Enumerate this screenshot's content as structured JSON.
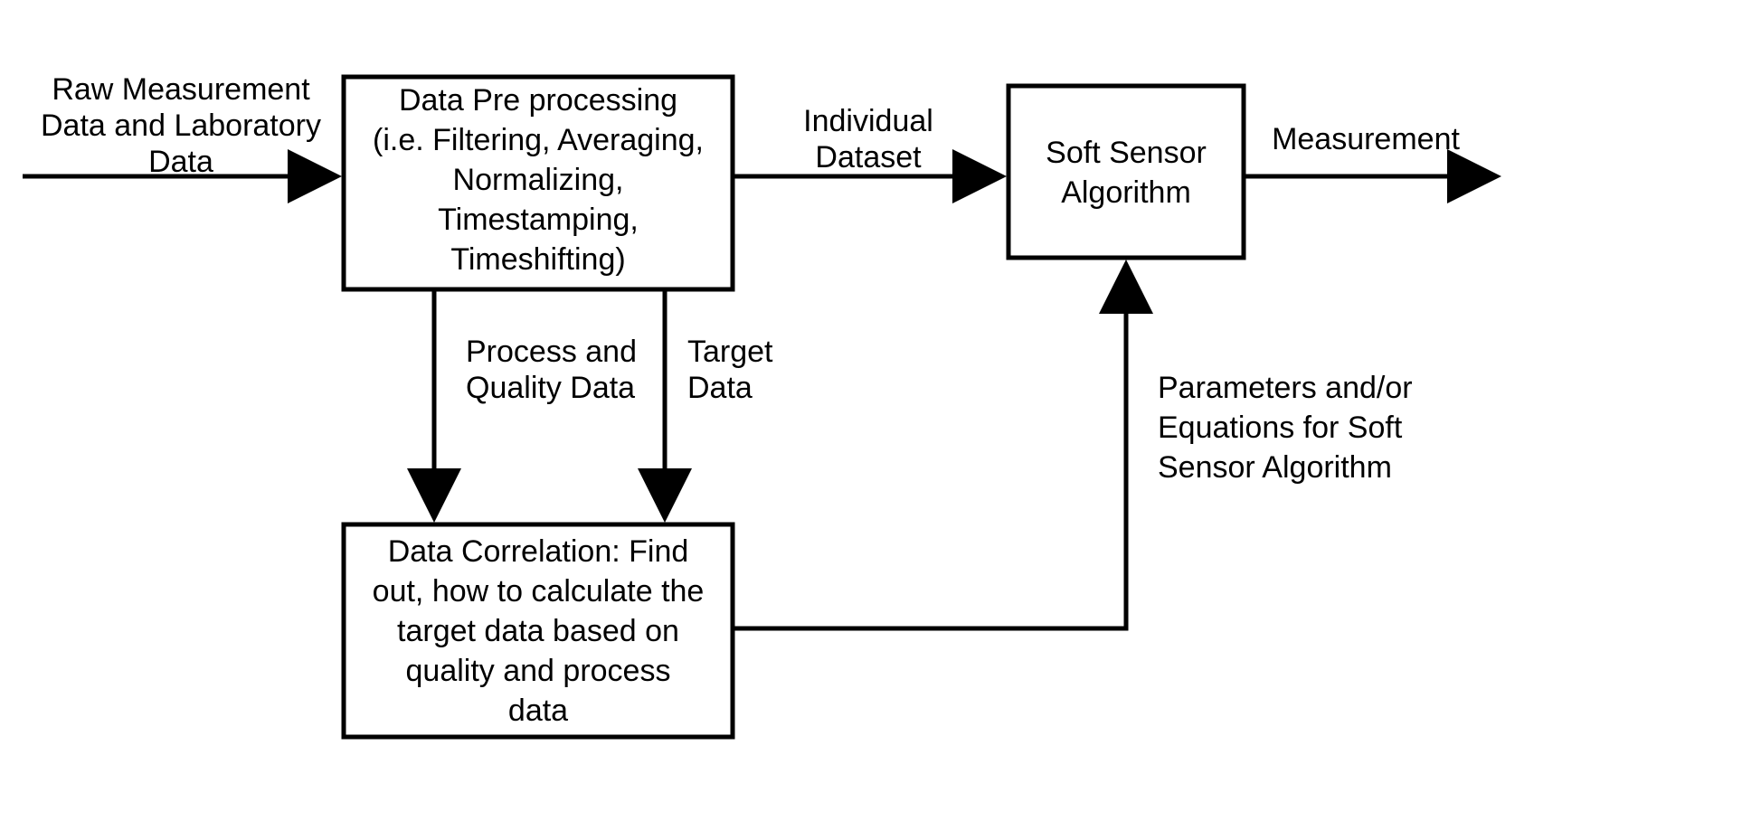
{
  "labels": {
    "input_l1": "Raw Measurement",
    "input_l2": "Data and Laboratory",
    "input_l3": "Data",
    "box1_l1": "Data Pre processing",
    "box1_l2": "(i.e. Filtering, Averaging,",
    "box1_l3": "Normalizing,",
    "box1_l4": "Timestamping,",
    "box1_l5": "Timeshifting)",
    "mid_l1": "Individual",
    "mid_l2": "Dataset",
    "box2_l1": "Soft Sensor",
    "box2_l2": "Algorithm",
    "output": "Measurement",
    "pq_l1": "Process and",
    "pq_l2": "Quality Data",
    "target_l1": "Target",
    "target_l2": "Data",
    "params_l1": "Parameters and/or",
    "params_l2": "Equations for Soft",
    "params_l3": "Sensor Algorithm",
    "box3_l1": "Data Correlation:  Find",
    "box3_l2": "out, how to calculate the",
    "box3_l3": "target data based on",
    "box3_l4": "quality and process",
    "box3_l5": "data"
  }
}
